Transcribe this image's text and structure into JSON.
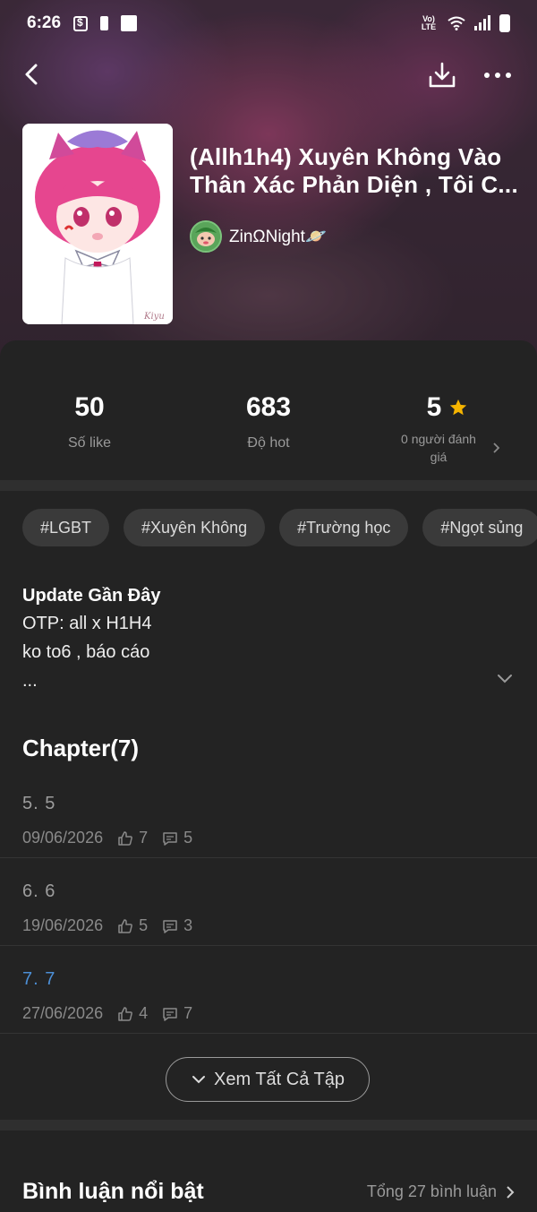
{
  "status_bar": {
    "time": "6:26",
    "network_label": "Vo) LTE"
  },
  "story": {
    "title": "(Allh1h4) Xuyên Không Vào Thân Xác Phản Diện , Tôi C...",
    "author": "ZinΩNight🪐",
    "cover_signature": "Kiyu"
  },
  "stats": {
    "likes_value": "50",
    "likes_label": "Số like",
    "hot_value": "683",
    "hot_label": "Độ hot",
    "rating_value": "5",
    "rating_label": "0 người đánh giá"
  },
  "tags": [
    "#LGBT",
    "#Xuyên Không",
    "#Trường học",
    "#Ngọt sủng"
  ],
  "update": {
    "title": "Update Gần Đây",
    "lines": [
      "OTP: all x H1H4",
      "ko to6 , báo cáo",
      "..."
    ]
  },
  "chapters": {
    "heading": "Chapter(7)",
    "items": [
      {
        "name": "5. 5",
        "date": "09/06/2026",
        "likes": "7",
        "comments": "5",
        "active": false
      },
      {
        "name": "6. 6",
        "date": "19/06/2026",
        "likes": "5",
        "comments": "3",
        "active": false
      },
      {
        "name": "7. 7",
        "date": "27/06/2026",
        "likes": "4",
        "comments": "7",
        "active": true
      }
    ],
    "see_all_label": "Xem Tất Cả Tập"
  },
  "comments": {
    "title": "Bình luận nổi bật",
    "total_label": "Tổng 27 bình luận"
  },
  "colors": {
    "background": "#232323",
    "accent_link": "#4c8fd6",
    "star": "#f5b400"
  }
}
